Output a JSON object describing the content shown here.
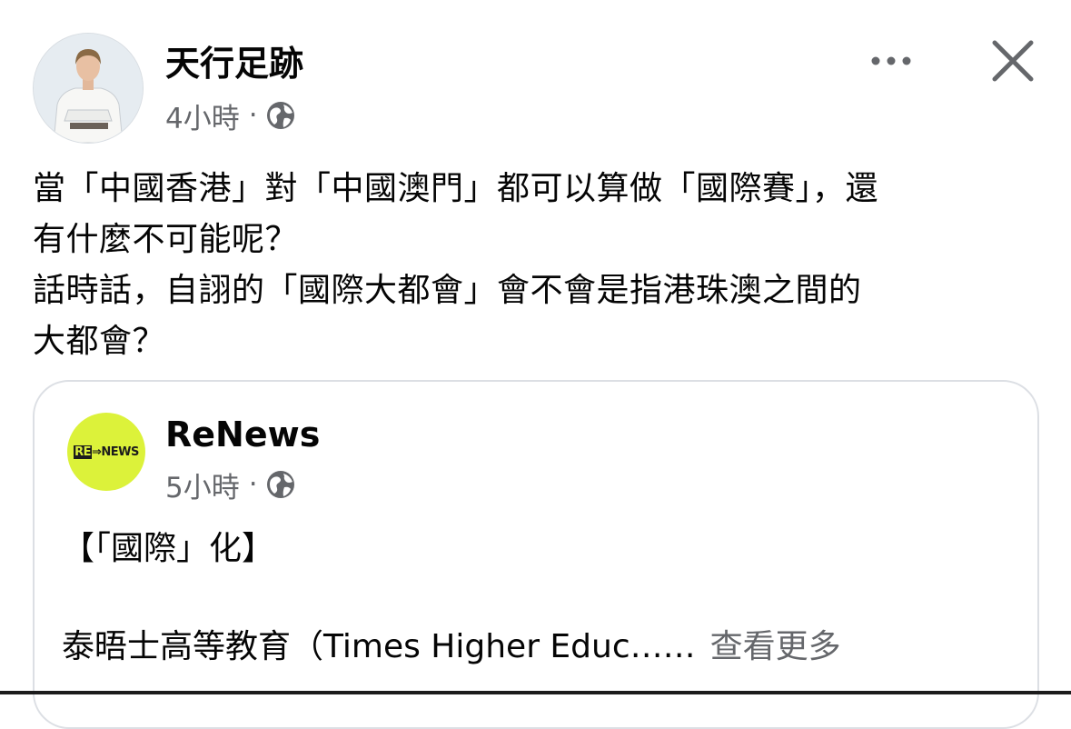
{
  "post": {
    "author": "天行足跡",
    "time": "4小時",
    "separator": "·",
    "privacy_icon": "globe-icon",
    "more_icon": "more-dots-icon",
    "close_icon": "close-icon",
    "text_lines": [
      "當「中國香港」對「中國澳門」都可以算做「國際賽」，還",
      "有什麼不可能呢？",
      "話時話，自詡的「國際大都會」會不會是指港珠澳之間的",
      "大都會？"
    ]
  },
  "shared": {
    "author": "ReNews",
    "logo_prefix": "RE",
    "logo_suffix": "NEWS",
    "time": "5小時",
    "separator": "·",
    "privacy_icon": "globe-icon",
    "headline": "【「國際」化】",
    "body_preview": "泰晤士高等教育（Times Higher Educ……",
    "see_more": "查看更多"
  },
  "colors": {
    "text": "#050505",
    "secondary_text": "#65676b",
    "logo_background": "#dcf23a",
    "card_border": "#dcdfe4"
  }
}
